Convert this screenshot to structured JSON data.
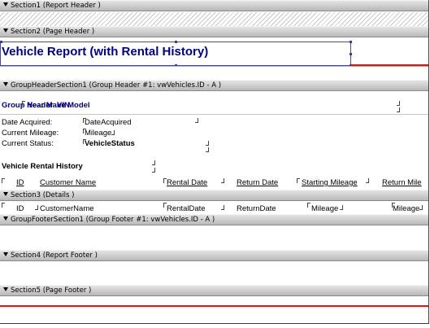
{
  "sections": {
    "report_header": "Section1 (Report Header )",
    "page_header": "Section2 (Page Header )",
    "group_header": "GroupHeaderSection1 (Group Header #1: vwVehicles.ID - A )",
    "details": "Section3 (Details )",
    "group_footer": "GroupFooterSection1 (Group Footer #1: vwVehicles.ID - A )",
    "report_footer": "Section4 (Report Footer )",
    "page_footer": "Section5 (Page Footer )"
  },
  "page_header": {
    "title": "Vehicle Report (with Rental History)"
  },
  "group_header": {
    "overlapped_fields": [
      "Group Header",
      "Year Make Model",
      "VIN"
    ],
    "labels": [
      "Date Acquired:",
      "Current Mileage:",
      "Current Status:"
    ],
    "values": [
      "DateAcquired",
      "Mileage",
      "VehicleStatus"
    ],
    "rental_title": "Vehicle Rental History",
    "columns": [
      "ID",
      "Customer Name",
      "Rental Date",
      "Return Date",
      "Starting Mileage",
      "Return Mile"
    ]
  },
  "details": {
    "fields": [
      "ID",
      "CustomerName",
      "RentalDate",
      "ReturnDate",
      "Mileage",
      "Mileage"
    ]
  },
  "colors": {
    "band": "#c8c8c8",
    "title_blue": "#000080",
    "red_line": "#e11414"
  }
}
